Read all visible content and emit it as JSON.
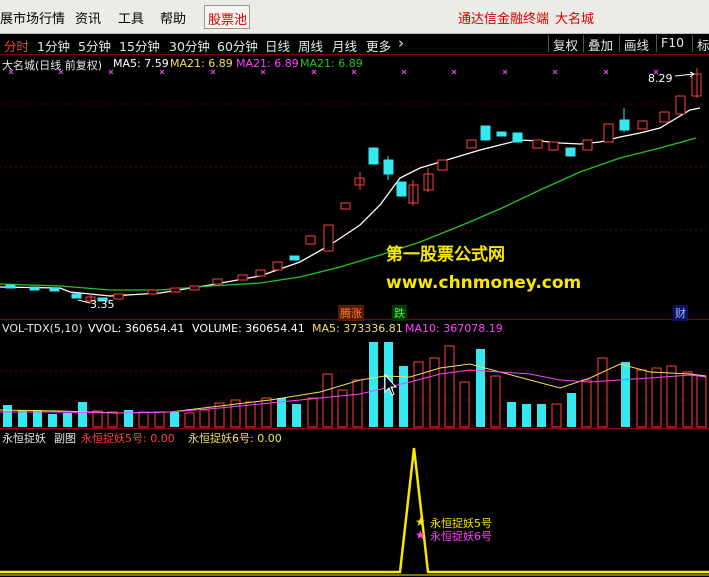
{
  "menubar": {
    "items": [
      "展市场行情",
      "资讯",
      "工具",
      "帮助"
    ],
    "stock_pool": "股票池",
    "broker": "通达信金融终端",
    "stock_name": "大名城"
  },
  "periods": {
    "items": [
      "分时",
      "1分钟",
      "5分钟",
      "15分钟",
      "30分钟",
      "60分钟",
      "日线",
      "周线",
      "月线",
      "更多"
    ],
    "more_arrow": "›",
    "active": "分时",
    "right_buttons": [
      "复权",
      "叠加",
      "画线",
      "F10",
      "标"
    ]
  },
  "main_panel": {
    "title": "大名城(日线 前复权)",
    "ma5": "MA5: 7.59",
    "ma21_a": "MA21: 6.89",
    "ma21_b": "MA21: 6.89",
    "ma21_c": "MA21: 6.89",
    "high_label": "8.29",
    "low_label": "3.35",
    "flag_up": "腾涨",
    "flag_down": "跌",
    "flag_fin": "财"
  },
  "watermark": {
    "line1": "第一股票公式网",
    "line2": "www.chnmoney.com"
  },
  "volume_panel": {
    "indicator": "VOL-TDX(5,10)",
    "vvol": "VVOL: 360654.41",
    "volume": "VOLUME: 360654.41",
    "ma5": "MA5: 373336.81",
    "ma10": "MA10: 367078.19"
  },
  "sub_panel": {
    "title": "永恒捉妖",
    "subtitle": "副图",
    "v1": "永恒捉妖5号: 0.00",
    "v2": "永恒捉妖6号: 0.00",
    "signal_5": "永恒捉妖5号",
    "signal_6": "永恒捉妖6号",
    "star": "★"
  },
  "colors": {
    "up": "#ff4040",
    "down": "#36e8f0",
    "ma5": "#ffffff",
    "ma_long": "#22c322",
    "ma5_vol": "#f0e060",
    "ma10_vol": "#ff40ff",
    "signal": "#f8e800",
    "accent": "#d40000"
  }
}
